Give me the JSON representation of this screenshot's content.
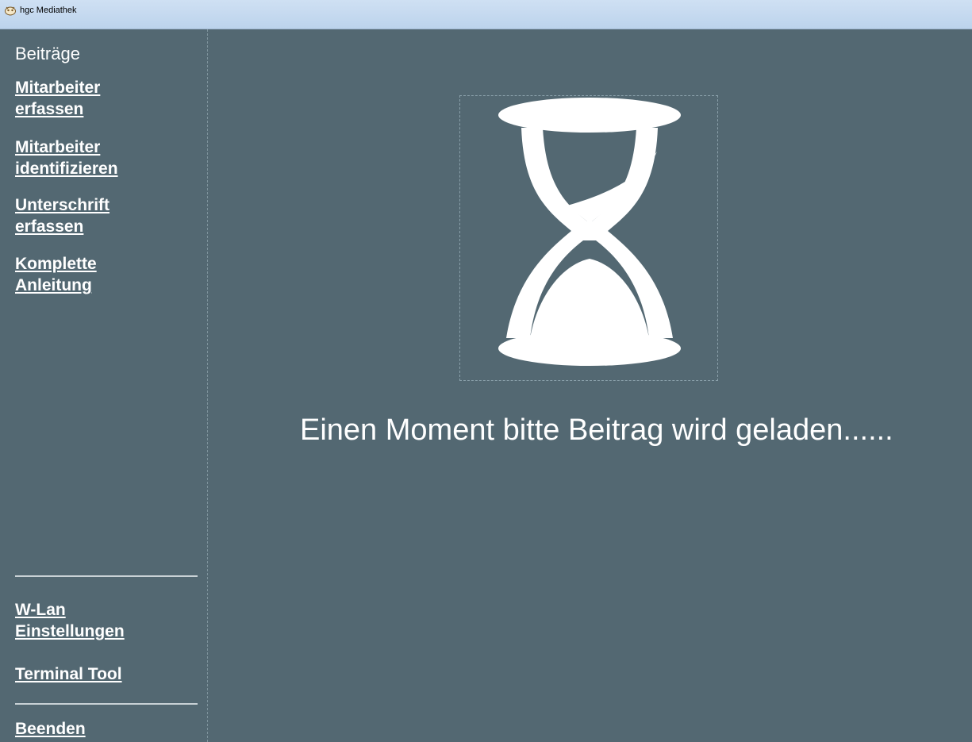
{
  "window": {
    "title": "hgc Mediathek",
    "icon": "app-logo-icon"
  },
  "sidebar": {
    "heading": "Beiträge",
    "links": [
      {
        "id": "mitarbeiter-erfassen",
        "label": "Mitarbeiter \nerfassen"
      },
      {
        "id": "mitarbeiter-identifizieren",
        "label": "Mitarbeiter \nidentifizieren"
      },
      {
        "id": "unterschrift-erfassen",
        "label": "Unterschrift \nerfassen"
      },
      {
        "id": "komplette-anleitung",
        "label": "Komplette \nAnleitung"
      }
    ],
    "bottom_links": [
      {
        "id": "wlan-einstellungen",
        "label": "W-Lan \nEinstellungen"
      },
      {
        "id": "terminal-tool",
        "label": "Terminal Tool"
      }
    ],
    "exit_label": "Beenden"
  },
  "main": {
    "icon": "hourglass-icon",
    "status_text": "Einen Moment bitte Beitrag wird geladen......"
  },
  "colors": {
    "background": "#536872",
    "text": "#ffffff",
    "titlebar": "#c6daf0"
  }
}
